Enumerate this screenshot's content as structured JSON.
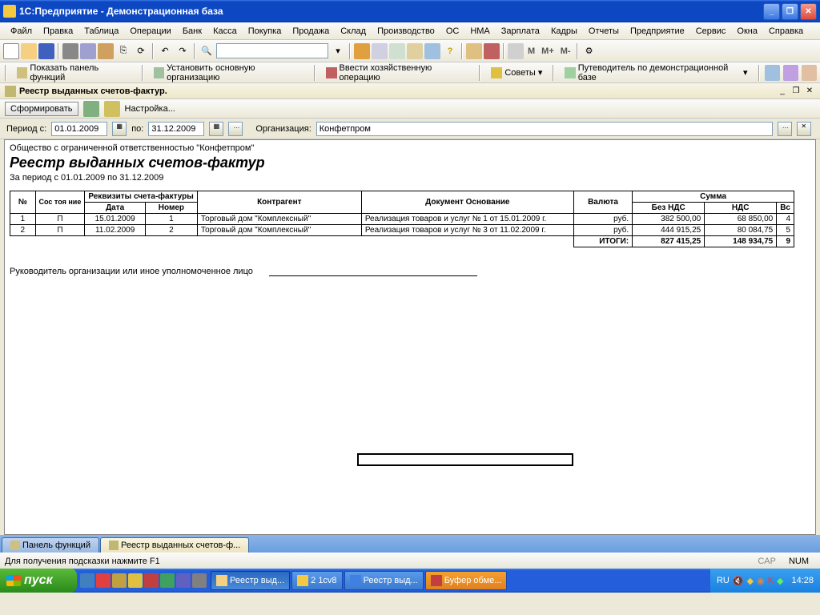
{
  "window": {
    "title": "1С:Предприятие - Демонстрационная база"
  },
  "menu": [
    "Файл",
    "Правка",
    "Таблица",
    "Операции",
    "Банк",
    "Касса",
    "Покупка",
    "Продажа",
    "Склад",
    "Производство",
    "ОС",
    "НМА",
    "Зарплата",
    "Кадры",
    "Отчеты",
    "Предприятие",
    "Сервис",
    "Окна",
    "Справка"
  ],
  "toolbar2": {
    "show_panel": "Показать панель функций",
    "set_org": "Установить основную организацию",
    "enter_op": "Ввести хозяйственную операцию",
    "tips": "Советы",
    "guide": "Путеводитель по демонстрационной базе"
  },
  "doc": {
    "title": "Реестр выданных счетов-фактур.",
    "toolbar": {
      "form": "Сформировать",
      "settings": "Настройка..."
    }
  },
  "filter": {
    "period_from_label": "Период с:",
    "period_from": "01.01.2009",
    "period_to_label": "по:",
    "period_to": "31.12.2009",
    "org_label": "Организация:",
    "org_value": "Конфетпром"
  },
  "report": {
    "company": "Общество с ограниченной ответственностью \"Конфетпром\"",
    "title": "Реестр выданных счетов-фактур",
    "period": "За период с 01.01.2009 по 31.12.2009",
    "headers": {
      "num": "№",
      "state": "Сос тоя ние",
      "req": "Реквизиты счета-фактуры",
      "date": "Дата",
      "number": "Номер",
      "counterparty": "Контрагент",
      "basis": "Документ Основание",
      "currency": "Валюта",
      "sum": "Сумма",
      "no_vat": "Без НДС",
      "vat": "НДС",
      "total": "Вс"
    },
    "rows": [
      {
        "n": "1",
        "s": "П",
        "date": "15.01.2009",
        "num": "1",
        "cp": "Торговый дом \"Комплексный\"",
        "basis": "Реализация товаров и услуг № 1 от 15.01.2009 г.",
        "cur": "руб.",
        "no_vat": "382 500,00",
        "vat": "68 850,00",
        "t": "4"
      },
      {
        "n": "2",
        "s": "П",
        "date": "11.02.2009",
        "num": "2",
        "cp": "Торговый дом \"Комплексный\"",
        "basis": "Реализация товаров и услуг № 3 от 11.02.2009 г.",
        "cur": "руб.",
        "no_vat": "444 915,25",
        "vat": "80 084,75",
        "t": "5"
      }
    ],
    "totals": {
      "label": "ИТОГИ:",
      "no_vat": "827 415,25",
      "vat": "148 934,75",
      "t": "9"
    },
    "signature": "Руководитель организации или иное уполномоченное лицо"
  },
  "tabs": {
    "panel": "Панель функций",
    "doc": "Реестр выданных счетов-ф..."
  },
  "status": {
    "help": "Для получения подсказки нажмите F1",
    "cap": "CAP",
    "num": "NUM"
  },
  "taskbar": {
    "start": "пуск",
    "items": [
      "Реестр выд...",
      "2 1cv8",
      "Реестр выд...",
      "Буфер обме..."
    ],
    "lang": "RU",
    "time": "14:28"
  }
}
